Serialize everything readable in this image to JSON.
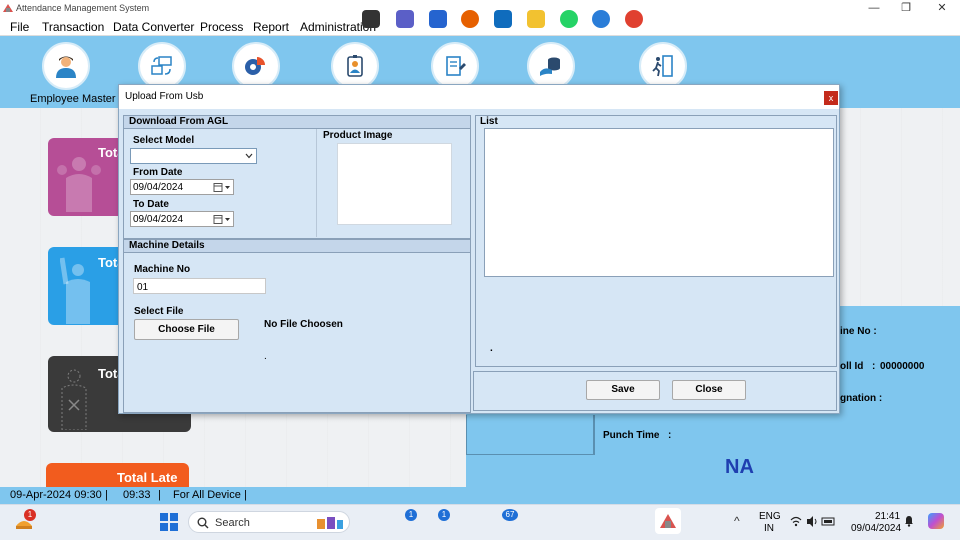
{
  "window": {
    "title": "Attendance Management System",
    "controls": {
      "minimize": "—",
      "restore": "❐",
      "close": "✕"
    }
  },
  "menu": [
    "File",
    "Transaction",
    "Data Converter",
    "Process",
    "Report",
    "Administration"
  ],
  "toolbar": {
    "items": [
      {
        "icon": "employee-icon",
        "label": "Employee Master"
      },
      {
        "icon": "sync-icon"
      },
      {
        "icon": "chart-icon"
      },
      {
        "icon": "id-badge-icon"
      },
      {
        "icon": "document-icon"
      },
      {
        "icon": "database-icon"
      },
      {
        "icon": "exit-icon"
      }
    ]
  },
  "dashboard": {
    "cards": [
      {
        "title": "Tota",
        "color": "#b64e96"
      },
      {
        "title": "Tota",
        "color": "#2a9fe6"
      },
      {
        "title": "Tota",
        "color": "#3a3a3a"
      },
      {
        "title": "Total Late",
        "color": "#f25c1e"
      }
    ],
    "details": {
      "machine_no_label": "ine No :",
      "roll_id_label": "oll Id",
      "roll_id_sep": ":",
      "roll_id_value": "00000000",
      "designation_label": "gnation :",
      "punch_time_label": "Punch Time",
      "punch_time_sep": ":",
      "na_text": "NA"
    }
  },
  "dialog": {
    "title": "Upload From Usb",
    "close_glyph": "x",
    "download_group": {
      "header": "Download From AGL",
      "select_model_label": "Select Model",
      "select_model_value": "",
      "from_date_label": "From Date",
      "from_date_value": "09/04/2024",
      "to_date_label": "To Date",
      "to_date_value": "09/04/2024",
      "product_image_label": "Product Image"
    },
    "machine_group": {
      "header": "Machine Details",
      "machine_no_label": "Machine No",
      "machine_no_value": "01",
      "select_file_label": "Select File",
      "choose_file_button": "Choose File",
      "file_status": "No File Choosen",
      "file_dot": "."
    },
    "list_group": {
      "header": "List",
      "dot": "."
    },
    "buttons": {
      "save": "Save",
      "close": "Close"
    }
  },
  "statusbar": {
    "date_time": "09-Apr-2024 09:30",
    "sep1": "|",
    "time": "09:33",
    "sep2": "|",
    "device": "For All Device",
    "sep3": "|"
  },
  "taskbar": {
    "search_placeholder": "Search",
    "weather_badge": "1",
    "teams_badge": "1",
    "todo_badge": "1",
    "mail_badge": "67",
    "language_line1": "ENG",
    "language_line2": "IN",
    "clock_time": "21:41",
    "clock_date": "09/04/2024",
    "tray_chevron": "^",
    "accent": "#1f6fd6"
  }
}
